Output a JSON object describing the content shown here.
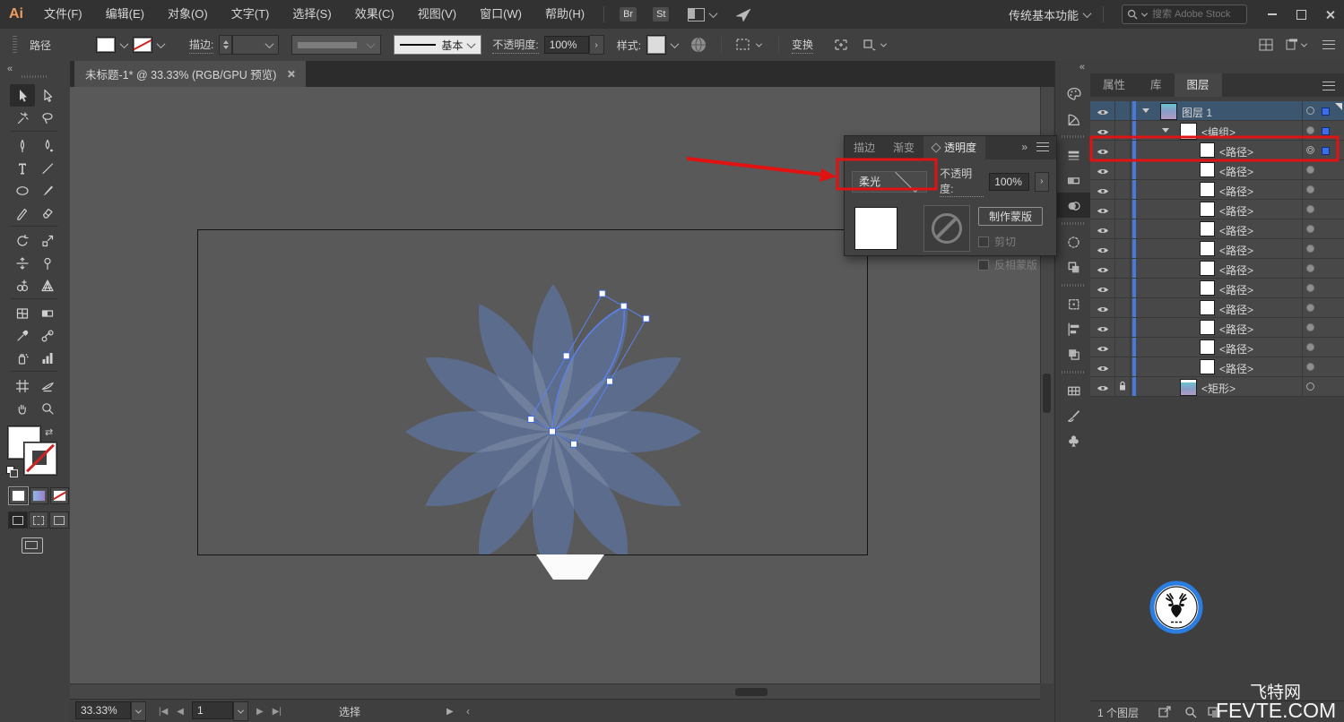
{
  "menubar": {
    "logo": "Ai",
    "items": [
      "文件(F)",
      "编辑(E)",
      "对象(O)",
      "文字(T)",
      "选择(S)",
      "效果(C)",
      "视图(V)",
      "窗口(W)",
      "帮助(H)"
    ],
    "bridge_button": "Br",
    "stock_button": "St",
    "workspace": "传统基本功能",
    "search_placeholder": "搜索 Adobe Stock"
  },
  "controlbar": {
    "context_label": "路径",
    "stroke_label": "描边:",
    "stroke_style": "基本",
    "opacity_label": "不透明度:",
    "opacity_value": "100%",
    "style_label": "样式:",
    "transform_label": "变换"
  },
  "document_tab": {
    "title": "未标题-1* @ 33.33% (RGB/GPU 预览)"
  },
  "toolbar": {
    "tools": [
      {
        "name": "selection-tool",
        "active": true
      },
      {
        "name": "direct-selection-tool"
      },
      {
        "name": "magic-wand-tool"
      },
      {
        "name": "lasso-tool",
        "sep": true
      },
      {
        "name": "pen-tool"
      },
      {
        "name": "curvature-tool"
      },
      {
        "name": "type-tool"
      },
      {
        "name": "line-segment-tool"
      },
      {
        "name": "ellipse-tool"
      },
      {
        "name": "paintbrush-tool"
      },
      {
        "name": "shaper-tool"
      },
      {
        "name": "eraser-tool",
        "sep": true
      },
      {
        "name": "rotate-tool"
      },
      {
        "name": "scale-tool"
      },
      {
        "name": "width-tool"
      },
      {
        "name": "puppet-warp-tool"
      },
      {
        "name": "shape-builder-tool"
      },
      {
        "name": "perspective-grid-tool",
        "sep": true
      },
      {
        "name": "mesh-tool"
      },
      {
        "name": "gradient-tool"
      },
      {
        "name": "eyedropper-tool"
      },
      {
        "name": "blend-tool"
      },
      {
        "name": "symbol-sprayer-tool"
      },
      {
        "name": "column-graph-tool",
        "sep": true
      },
      {
        "name": "artboard-tool"
      },
      {
        "name": "slice-tool"
      },
      {
        "name": "hand-tool"
      },
      {
        "name": "zoom-tool"
      }
    ]
  },
  "dock": [
    {
      "name": "color-panel"
    },
    {
      "name": "color-guide-panel",
      "sep": true
    },
    {
      "name": "stroke-panel"
    },
    {
      "name": "gradient-panel"
    },
    {
      "name": "transparency-panel",
      "active": true,
      "sep": true
    },
    {
      "name": "appearance-panel"
    },
    {
      "name": "graphic-styles-panel",
      "sep": true
    },
    {
      "name": "transform-panel"
    },
    {
      "name": "align-panel"
    },
    {
      "name": "pathfinder-panel",
      "sep": true
    },
    {
      "name": "swatches-panel"
    },
    {
      "name": "brushes-panel"
    },
    {
      "name": "symbols-panel"
    }
  ],
  "transparency_panel": {
    "tabs": [
      "描边",
      "渐变",
      "透明度"
    ],
    "blend_mode": "柔光",
    "opacity_label": "不透明度:",
    "opacity_value": "100%",
    "make_mask_button": "制作蒙版",
    "clip_checkbox": "剪切",
    "invert_mask_checkbox": "反相蒙版"
  },
  "layers_panel": {
    "tabs": [
      "属性",
      "库",
      "图层"
    ],
    "rows": [
      {
        "label": "图层 1",
        "kind": "layer",
        "chevron": true,
        "indent": 78,
        "thumb": "layer",
        "selected": true,
        "target": "ring",
        "blue_sq": true
      },
      {
        "label": "<编组>",
        "kind": "group",
        "chevron": true,
        "indent": 100,
        "thumb": "white",
        "target": "dot",
        "blue_sq": true
      },
      {
        "label": "<路径>",
        "kind": "path",
        "indent": 122,
        "thumb": "white",
        "target": "double",
        "blue_sq": true,
        "red_highlight": true
      },
      {
        "label": "<路径>",
        "kind": "path",
        "indent": 122,
        "thumb": "white",
        "target": "dot"
      },
      {
        "label": "<路径>",
        "kind": "path",
        "indent": 122,
        "thumb": "white",
        "target": "dot"
      },
      {
        "label": "<路径>",
        "kind": "path",
        "indent": 122,
        "thumb": "white",
        "target": "dot"
      },
      {
        "label": "<路径>",
        "kind": "path",
        "indent": 122,
        "thumb": "white",
        "target": "dot"
      },
      {
        "label": "<路径>",
        "kind": "path",
        "indent": 122,
        "thumb": "white",
        "target": "dot"
      },
      {
        "label": "<路径>",
        "kind": "path",
        "indent": 122,
        "thumb": "white",
        "target": "dot"
      },
      {
        "label": "<路径>",
        "kind": "path",
        "indent": 122,
        "thumb": "white",
        "target": "dot"
      },
      {
        "label": "<路径>",
        "kind": "path",
        "indent": 122,
        "thumb": "white",
        "target": "dot"
      },
      {
        "label": "<路径>",
        "kind": "path",
        "indent": 122,
        "thumb": "white",
        "target": "dot"
      },
      {
        "label": "<路径>",
        "kind": "path",
        "indent": 122,
        "thumb": "white",
        "target": "dot"
      },
      {
        "label": "<路径>",
        "kind": "path",
        "indent": 122,
        "thumb": "white",
        "target": "dot"
      },
      {
        "label": "<矩形>",
        "kind": "rect",
        "indent": 100,
        "thumb": "rect",
        "lock": true,
        "target": "ring"
      }
    ],
    "footer_count": "1 个图层"
  },
  "statusbar": {
    "zoom_value": "33.33%",
    "artboard_value": "1",
    "status_text": "选择"
  },
  "watermark": {
    "line1": "飞特网",
    "line2": "FEVTE.COM"
  },
  "artboard": {
    "gradient_top": "#66c4ce",
    "gradient_mid": "#8f9fc8",
    "gradient_bottom": "#b89dc5",
    "petal_base_color": "#2f57a0",
    "petal_count": 12
  },
  "colors": {
    "annotation_red": "#e01212",
    "selection_blue": "#5b83f0",
    "layer_selected_bg": "#3b566e"
  }
}
